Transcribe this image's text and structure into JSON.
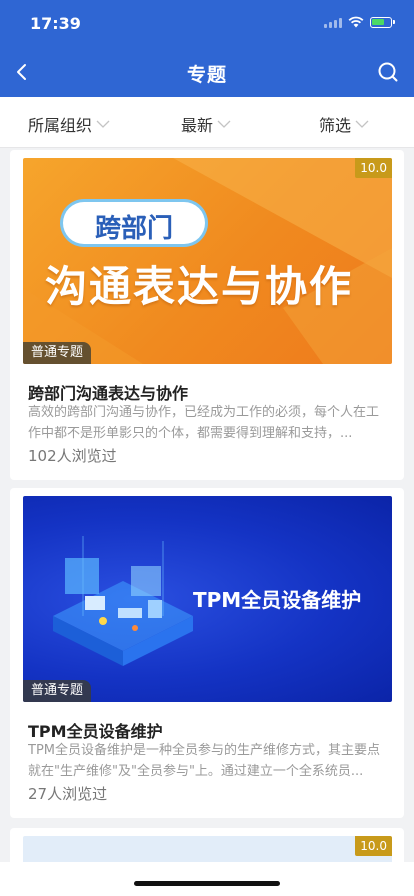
{
  "status": {
    "time": "17:39"
  },
  "header": {
    "title": "专题"
  },
  "filters": [
    {
      "label": "所属组织"
    },
    {
      "label": "最新"
    },
    {
      "label": "筛选"
    }
  ],
  "cards": [
    {
      "cover_line1": "跨部门",
      "cover_line2": "沟通表达与协作",
      "score": "10.0",
      "tag": "普通专题",
      "title": "跨部门沟通表达与协作",
      "desc": "高效的跨部门沟通与协作，已经成为工作的必须，每个人在工作中都不是形单影只的个体，都需要得到理解和支持，...",
      "views": "102人浏览过"
    },
    {
      "cover_text": "TPM全员设备维护",
      "tag": "普通专题",
      "title": "TPM全员设备维护",
      "desc": "TPM全员设备维护是一种全员参与的生产维修方式，其主要点就在\"生产维修\"及\"全员参与\"上。通过建立一个全系统员...",
      "views": "27人浏览过"
    },
    {
      "score": "10.0"
    }
  ],
  "colors": {
    "header_bg": "#2f66d3",
    "score_bg": "#c89a1a"
  }
}
